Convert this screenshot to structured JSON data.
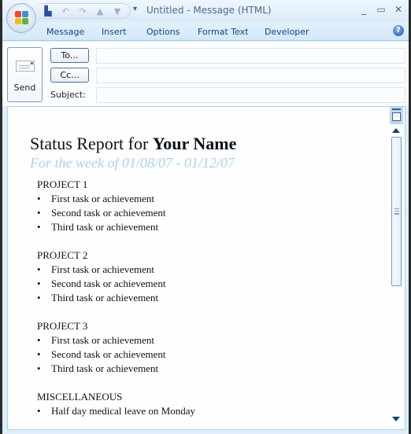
{
  "window": {
    "title": "Untitled - Message (HTML)",
    "controls": {
      "minimize": "_",
      "maximize": "▭",
      "close": "✕"
    },
    "quick_access": [
      "save-icon",
      "undo-icon",
      "redo-icon",
      "previous-item-icon",
      "next-item-icon"
    ],
    "qat_more": "▾"
  },
  "ribbon": {
    "tabs": [
      "Message",
      "Insert",
      "Options",
      "Format Text",
      "Developer"
    ],
    "help": "?"
  },
  "header": {
    "send_label": "Send",
    "to_label": "To...",
    "cc_label": "Cc...",
    "subject_label": "Subject:",
    "to_value": "",
    "cc_value": "",
    "subject_value": ""
  },
  "document": {
    "title_regular": "Status Report for ",
    "title_bold": "Your Name",
    "subtitle": "For the week of 01/08/07 - 01/12/07",
    "sections": [
      {
        "heading": "PROJECT 1",
        "items": [
          "First task or achievement",
          "Second task or achievement",
          "Third task or achievement"
        ]
      },
      {
        "heading": "PROJECT 2",
        "items": [
          "First task or achievement",
          "Second task or achievement",
          "Third task or achievement"
        ]
      },
      {
        "heading": "PROJECT 3",
        "items": [
          "First task or achievement",
          "Second task or achievement",
          "Third task or achievement"
        ]
      },
      {
        "heading": "MISCELLANEOUS",
        "items": [
          "Half day medical leave on Monday"
        ]
      }
    ],
    "bullet": "•"
  }
}
